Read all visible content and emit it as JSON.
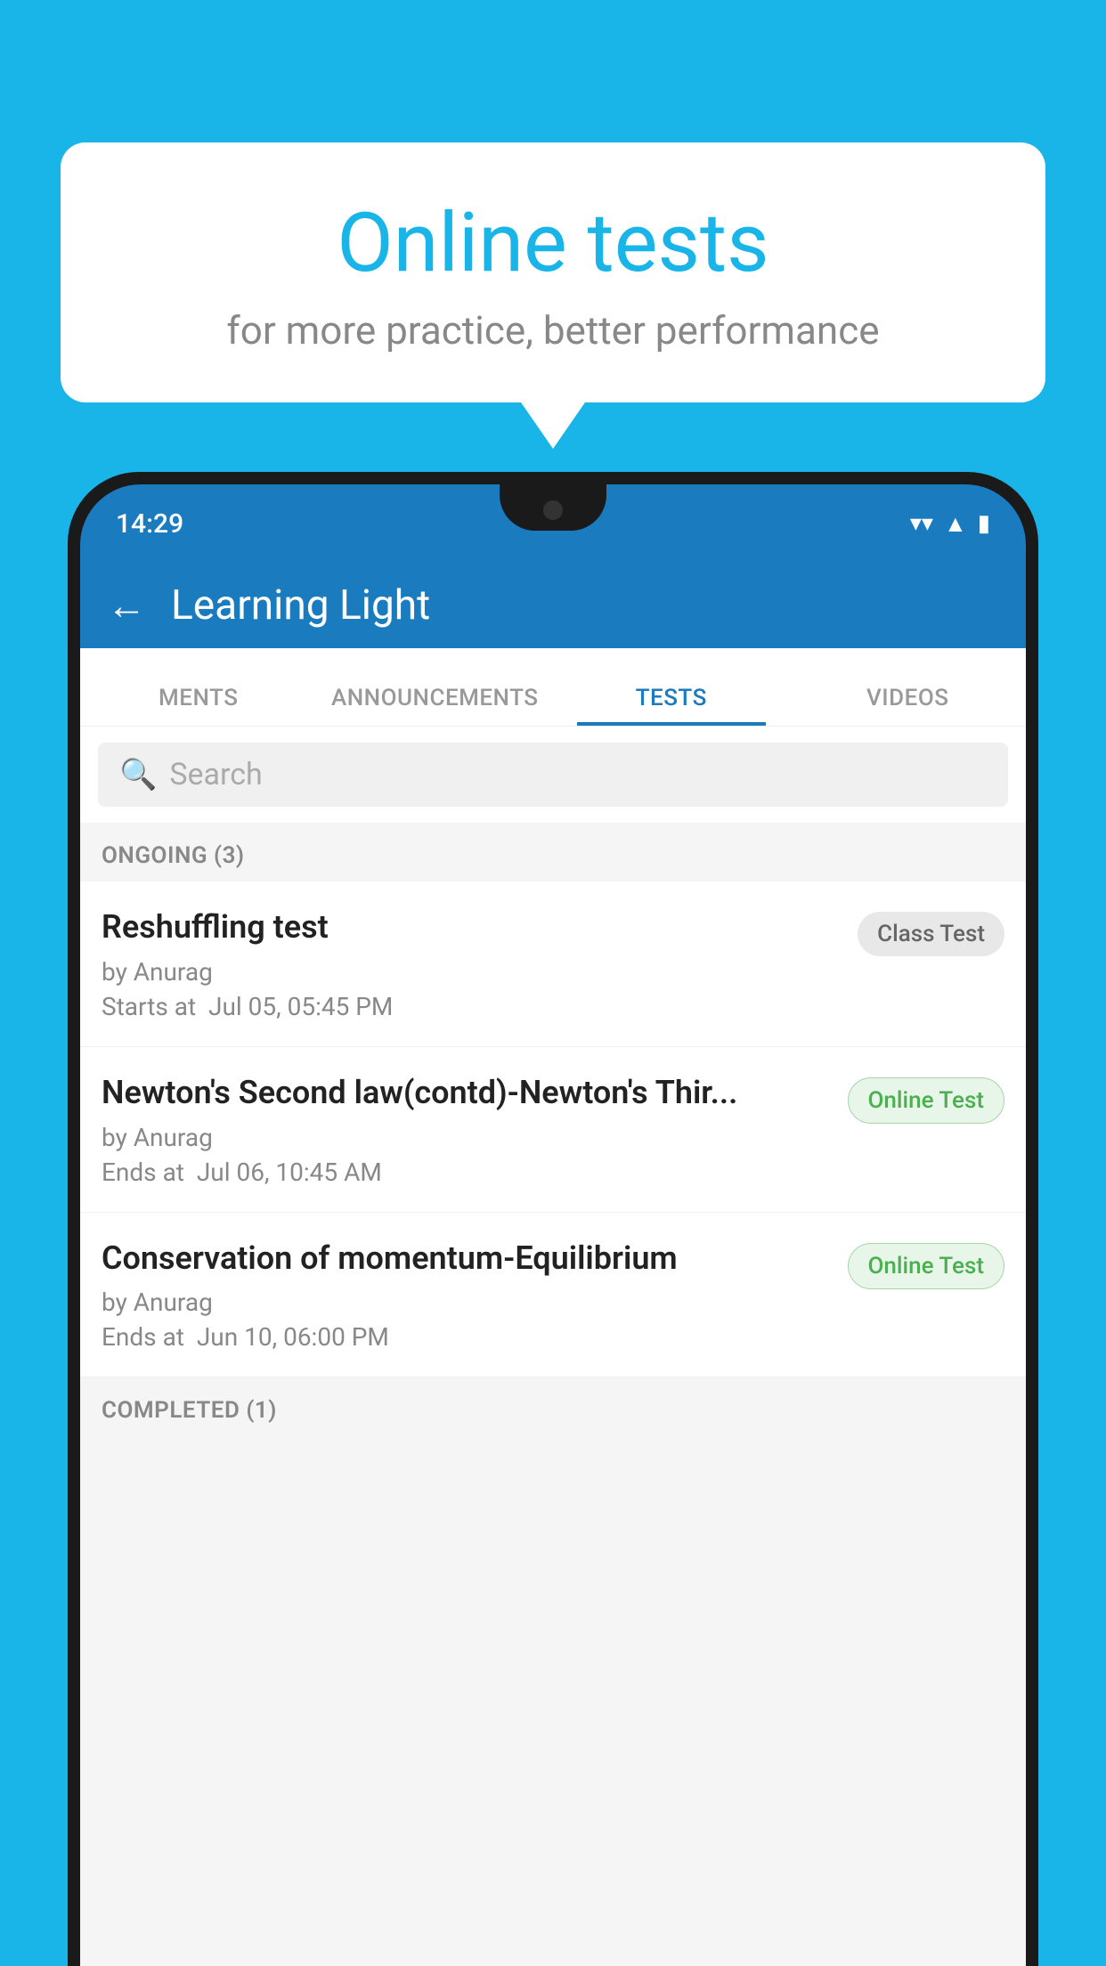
{
  "background_color": "#1ab5e8",
  "bubble": {
    "title": "Online tests",
    "subtitle": "for more practice, better performance"
  },
  "phone": {
    "status_bar": {
      "time": "14:29",
      "icons": [
        "wifi",
        "signal",
        "battery"
      ]
    },
    "header": {
      "back_label": "←",
      "title": "Learning Light"
    },
    "tabs": [
      {
        "label": "MENTS",
        "active": false
      },
      {
        "label": "ANNOUNCEMENTS",
        "active": false
      },
      {
        "label": "TESTS",
        "active": true
      },
      {
        "label": "VIDEOS",
        "active": false
      }
    ],
    "search": {
      "placeholder": "Search",
      "icon": "🔍"
    },
    "sections": [
      {
        "header": "ONGOING (3)",
        "tests": [
          {
            "name": "Reshuffling test",
            "author": "by Anurag",
            "time_label": "Starts at",
            "time_value": "Jul 05, 05:45 PM",
            "badge": "Class Test",
            "badge_type": "class"
          },
          {
            "name": "Newton's Second law(contd)-Newton's Thir...",
            "author": "by Anurag",
            "time_label": "Ends at",
            "time_value": "Jul 06, 10:45 AM",
            "badge": "Online Test",
            "badge_type": "online"
          },
          {
            "name": "Conservation of momentum-Equilibrium",
            "author": "by Anurag",
            "time_label": "Ends at",
            "time_value": "Jun 10, 06:00 PM",
            "badge": "Online Test",
            "badge_type": "online"
          }
        ]
      },
      {
        "header": "COMPLETED (1)",
        "tests": []
      }
    ]
  }
}
